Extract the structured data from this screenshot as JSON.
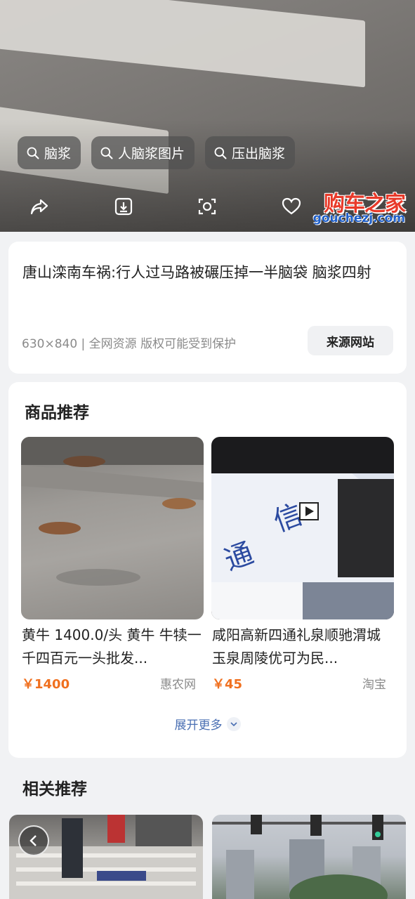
{
  "hero": {
    "chips": [
      {
        "label": "脑浆",
        "icon": "search-icon"
      },
      {
        "label": "人脑浆图片",
        "icon": "search-icon"
      },
      {
        "label": "压出脑浆",
        "icon": "search-icon"
      }
    ],
    "actions": [
      "share-icon",
      "download-icon",
      "image-search-icon",
      "like-icon"
    ],
    "watermark": {
      "cn": "购车之家",
      "en": "gouchezj.com"
    }
  },
  "info": {
    "title": "唐山滦南车祸:行人过马路被碾压掉一半脑袋  脑浆四射",
    "meta": "630×840 | 全网资源 版权可能受到保护",
    "source_button": "来源网站"
  },
  "goods": {
    "title": "商品推荐",
    "items": [
      {
        "name": "黄牛 1400.0/头 黄牛  牛犊一千四百元一头批发...",
        "price": "￥1400",
        "shop": "惠农网"
      },
      {
        "name": "咸阳高新四通礼泉顺驰渭城玉泉周陵优可为民...",
        "price": "￥45",
        "shop": "淘宝"
      }
    ],
    "more": "展开更多"
  },
  "related": {
    "title": "相关推荐"
  },
  "colors": {
    "price": "#f0701f",
    "link": "#4a6fb3"
  }
}
